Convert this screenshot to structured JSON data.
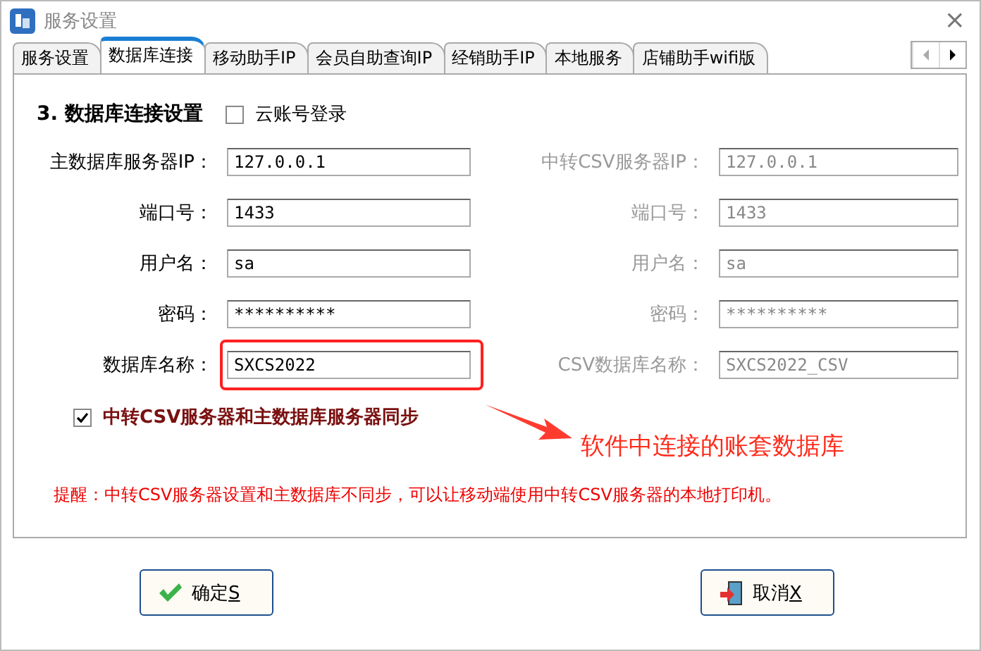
{
  "window": {
    "title": "服务设置",
    "close": "×"
  },
  "tabs": [
    {
      "label": "服务设置",
      "selected": false
    },
    {
      "label": "数据库连接",
      "selected": true
    },
    {
      "label": "移动助手IP",
      "selected": false
    },
    {
      "label": "会员自助查询IP",
      "selected": false
    },
    {
      "label": "经销助手IP",
      "selected": false
    },
    {
      "label": "本地服务",
      "selected": false
    },
    {
      "label": "店铺助手wifi版",
      "selected": false
    }
  ],
  "section": {
    "title": "3. 数据库连接设置",
    "cloud_login": {
      "label": "云账号登录",
      "checked": false
    }
  },
  "rows": [
    {
      "left": {
        "label": "主数据库服务器IP：",
        "value": "127.0.0.1",
        "disabled": false
      },
      "right": {
        "label": "中转CSV服务器IP：",
        "value": "127.0.0.1",
        "disabled": true
      }
    },
    {
      "left": {
        "label": "端口号：",
        "value": "1433",
        "disabled": false
      },
      "right": {
        "label": "端口号：",
        "value": "1433",
        "disabled": true
      }
    },
    {
      "left": {
        "label": "用户名：",
        "value": "sa",
        "disabled": false
      },
      "right": {
        "label": "用户名：",
        "value": "sa",
        "disabled": true
      }
    },
    {
      "left": {
        "label": "密码：",
        "value": "**********",
        "disabled": false
      },
      "right": {
        "label": "密码：",
        "value": "**********",
        "disabled": true
      }
    },
    {
      "left": {
        "label": "数据库名称：",
        "value": "SXCS2022",
        "disabled": false
      },
      "right": {
        "label": "CSV数据库名称：",
        "value": "SXCS2022_CSV",
        "disabled": true
      }
    }
  ],
  "sync": {
    "label": "中转CSV服务器和主数据库服务器同步",
    "checked": true
  },
  "annotation": {
    "text": "软件中连接的账套数据库"
  },
  "hint": "提醒：中转CSV服务器设置和主数据库不同步，可以让移动端使用中转CSV服务器的本地打印机。",
  "buttons": [
    {
      "kind": "ok",
      "label": "确定",
      "accelerator": "S"
    },
    {
      "kind": "cancel",
      "label": "取消",
      "accelerator": "X"
    }
  ]
}
